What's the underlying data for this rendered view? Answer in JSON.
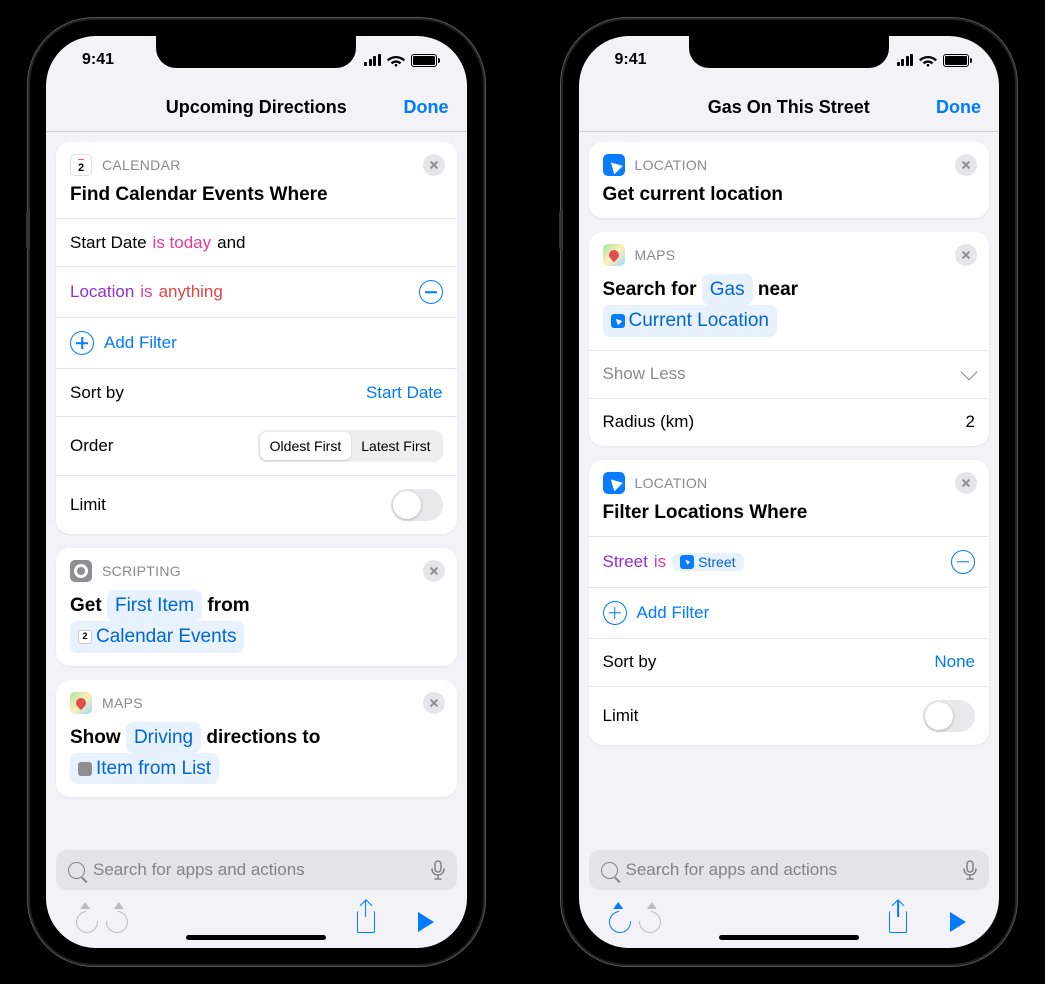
{
  "status_time": "9:41",
  "phone_a": {
    "nav_title": "Upcoming Directions",
    "done": "Done",
    "card1": {
      "cat": "CALENDAR",
      "title": "Find Calendar Events Where",
      "filter1_field": "Start Date",
      "filter1_op": "is today",
      "filter1_join": "and",
      "filter2_field": "Location",
      "filter2_op": "is",
      "filter2_val": "anything",
      "add_filter": "Add Filter",
      "sort_label": "Sort by",
      "sort_value": "Start Date",
      "order_label": "Order",
      "order_opt1": "Oldest First",
      "order_opt2": "Latest First",
      "limit_label": "Limit"
    },
    "card2": {
      "cat": "SCRIPTING",
      "get": "Get",
      "first_item": "First Item",
      "from": "from",
      "cal_events": "Calendar Events"
    },
    "card3": {
      "cat": "MAPS",
      "show": "Show",
      "driving": "Driving",
      "directions_to": "directions to",
      "item_from_list": "Item from List"
    },
    "search_placeholder": "Search for apps and actions"
  },
  "phone_b": {
    "nav_title": "Gas On This Street",
    "done": "Done",
    "card1": {
      "cat": "LOCATION",
      "title": "Get current location"
    },
    "card2": {
      "cat": "MAPS",
      "search_for": "Search for",
      "gas": "Gas",
      "near": "near",
      "cur_loc": "Current Location",
      "show_less": "Show Less",
      "radius_label": "Radius (km)",
      "radius_value": "2"
    },
    "card3": {
      "cat": "LOCATION",
      "title": "Filter Locations Where",
      "filter_field": "Street",
      "filter_op": "is",
      "filter_val": "Street",
      "add_filter": "Add Filter",
      "sort_label": "Sort by",
      "sort_value": "None",
      "limit_label": "Limit"
    },
    "search_placeholder": "Search for apps and actions"
  }
}
